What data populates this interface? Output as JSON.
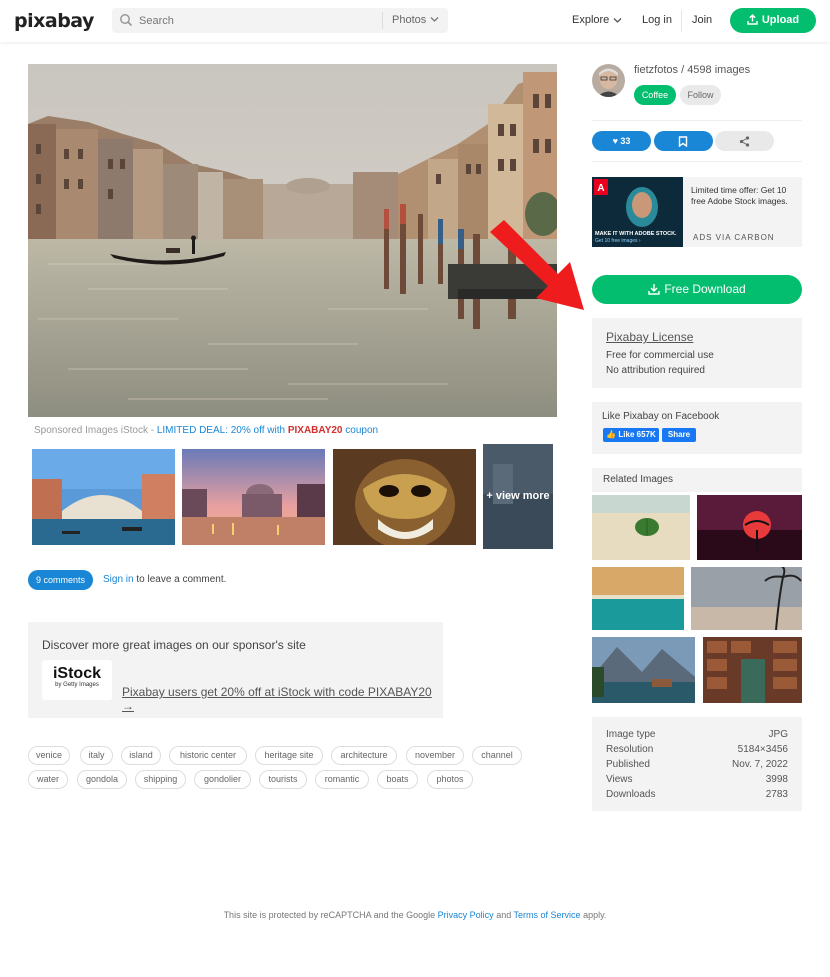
{
  "header": {
    "logo": "pixabay",
    "search_placeholder": "Search",
    "search_type": "Photos",
    "explore": "Explore",
    "login": "Log in",
    "join": "Join",
    "upload": "Upload",
    "accent": "#02be6e"
  },
  "sponsored": {
    "prefix": "Sponsored Images iStock - ",
    "deal": "LIMITED DEAL: 20% off with ",
    "code": "PIXABAY20",
    "suffix": " coupon",
    "view_more": "+ view more"
  },
  "comments": {
    "badge": "9 comments",
    "signin": "Sign in",
    "rest": " to leave a comment."
  },
  "sponsor_box": {
    "title": "Discover more great images on our sponsor's site",
    "logo_big": "iStock",
    "logo_small": "by Getty Images",
    "link": "Pixabay users get 20% off at iStock with code PIXABAY20 →"
  },
  "tags": [
    "venice",
    "italy",
    "island",
    "historic center",
    "heritage site",
    "architecture",
    "november",
    "channel",
    "water",
    "gondola",
    "shipping",
    "gondolier",
    "tourists",
    "romantic",
    "boats",
    "photos"
  ],
  "user": {
    "line": "fietzfotos / 4598 images",
    "coffee": "Coffee",
    "follow": "Follow"
  },
  "actions": {
    "likes": "33"
  },
  "ad": {
    "text": "Limited time offer: Get 10 free Adobe Stock images.",
    "via": "ADS VIA CARBON",
    "img_line1": "MAKE IT WITH ADOBE STOCK.",
    "img_line2": "Get 10 free images ›"
  },
  "download": {
    "label": "Free Download"
  },
  "license": {
    "title": "Pixabay License",
    "line1": "Free for commercial use",
    "line2": "No attribution required"
  },
  "facebook": {
    "title": "Like Pixabay on Facebook",
    "like": "Like 657K",
    "share": "Share"
  },
  "related": {
    "title": "Related Images"
  },
  "details": [
    {
      "key": "Image type",
      "value": "JPG"
    },
    {
      "key": "Resolution",
      "value": "5184×3456"
    },
    {
      "key": "Published",
      "value": "Nov. 7, 2022"
    },
    {
      "key": "Views",
      "value": "3998"
    },
    {
      "key": "Downloads",
      "value": "2783"
    }
  ],
  "footer": {
    "p1": "This site is protected by reCAPTCHA and the Google ",
    "privacy": "Privacy Policy",
    "p2": " and ",
    "terms": "Terms of Service",
    "p3": " apply."
  }
}
